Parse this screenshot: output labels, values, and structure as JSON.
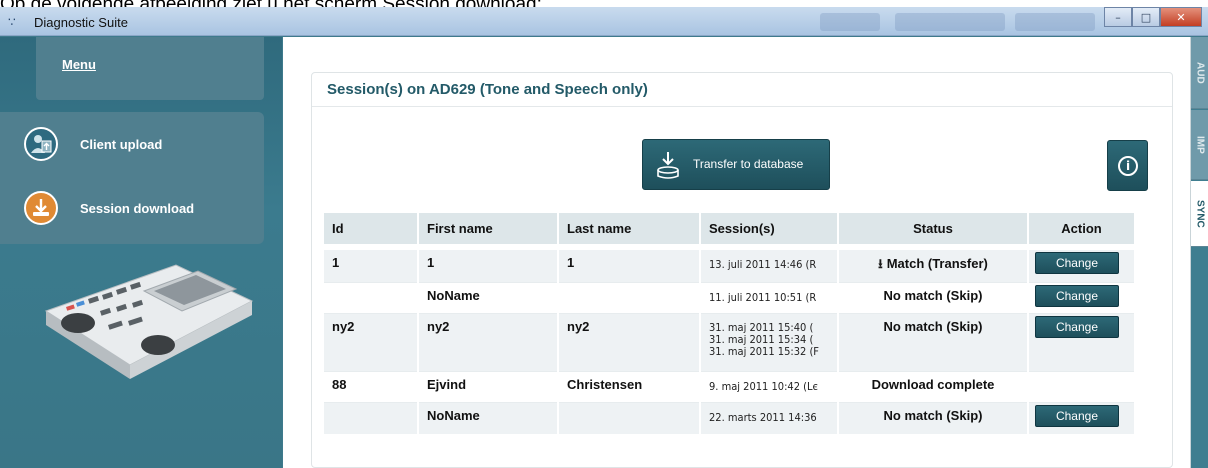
{
  "caption": "Op de volgende afbeelding ziet u het scherm Session download:",
  "window": {
    "title": "Diagnostic Suite",
    "icon": "app-logo-icon",
    "controls": [
      "minimize",
      "maximize",
      "close"
    ]
  },
  "sidebar": {
    "menu_label": "Menu",
    "items": [
      {
        "label": "Client upload",
        "icon": "client-upload-icon"
      },
      {
        "label": "Session download",
        "icon": "session-download-icon"
      }
    ],
    "device_image": "audiometer-device"
  },
  "panel": {
    "title": "Session(s) on AD629 (Tone and Speech only)",
    "transfer_label": "Transfer to database",
    "info_icon": "info-icon"
  },
  "table": {
    "columns": [
      "Id",
      "First name",
      "Last name",
      "Session(s)",
      "Status",
      "Action"
    ],
    "rows": [
      {
        "id": "1",
        "first": "1",
        "last": "1",
        "sessions": [
          "13. juli 2011 14:46 (R"
        ],
        "status": "Match (Transfer)",
        "status_icon": "download-icon",
        "action": "Change"
      },
      {
        "id": "",
        "first": "NoName",
        "last": "",
        "sessions": [
          "11. juli 2011 10:51 (R"
        ],
        "status": "No match (Skip)",
        "action": "Change"
      },
      {
        "id": "ny2",
        "first": "ny2",
        "last": "ny2",
        "sessions": [
          "31. maj 2011 15:40 (",
          "31. maj 2011 15:34 (",
          "31. maj 2011 15:32 (F"
        ],
        "status": "No match (Skip)",
        "action": "Change"
      },
      {
        "id": "88",
        "first": "Ejvind",
        "last": "Christensen",
        "sessions": [
          "9. maj 2011 10:42 (Lє"
        ],
        "status": "Download complete",
        "action": ""
      },
      {
        "id": "",
        "first": "NoName",
        "last": "",
        "sessions": [
          "22. marts 2011 14:36"
        ],
        "status": "No match (Skip)",
        "action": "Change"
      }
    ]
  },
  "right_tabs": [
    {
      "label": "AUD",
      "active": false
    },
    {
      "label": "IMP",
      "active": false
    },
    {
      "label": "SYNC",
      "active": true
    }
  ],
  "colors": {
    "teal_dark": "#1e4f5b",
    "teal_panel": "#3e7a8c",
    "title_text": "#235a68"
  }
}
